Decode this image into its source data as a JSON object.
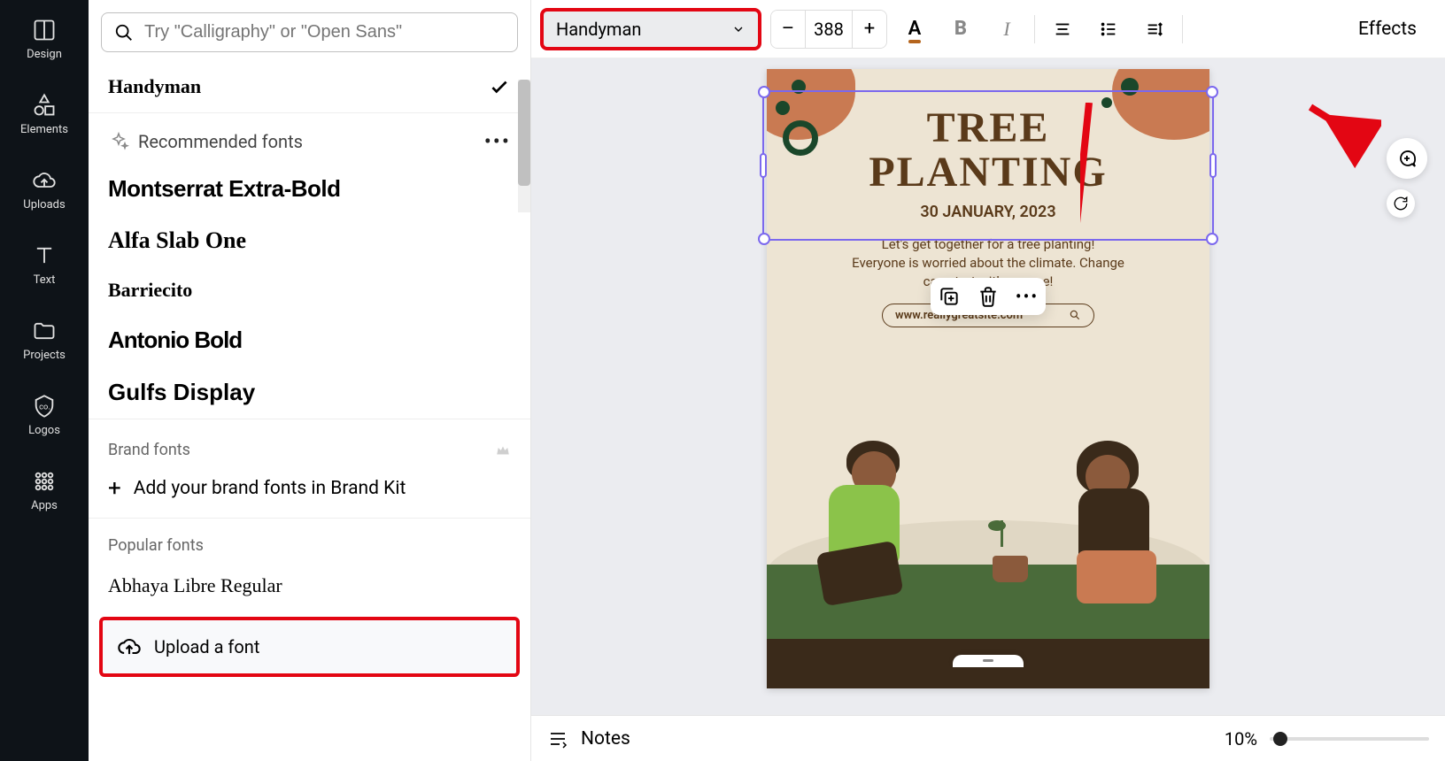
{
  "leftnav": {
    "items": [
      {
        "label": "Design",
        "icon": "design"
      },
      {
        "label": "Elements",
        "icon": "elements"
      },
      {
        "label": "Uploads",
        "icon": "uploads"
      },
      {
        "label": "Text",
        "icon": "text"
      },
      {
        "label": "Projects",
        "icon": "projects"
      },
      {
        "label": "Logos",
        "icon": "logos"
      },
      {
        "label": "Apps",
        "icon": "apps"
      }
    ]
  },
  "panel": {
    "search_placeholder": "Try \"Calligraphy\" or \"Open Sans\"",
    "selected_font": "Handyman",
    "recommended_title": "Recommended fonts",
    "recommended": [
      {
        "name": "Montserrat Extra-Bold",
        "cls": "f-montserrat"
      },
      {
        "name": "Alfa Slab One",
        "cls": "f-alfa"
      },
      {
        "name": "Barriecito",
        "cls": "f-barriecito"
      },
      {
        "name": "Antonio Bold",
        "cls": "f-antonio"
      },
      {
        "name": "Gulfs Display",
        "cls": "f-gulfs"
      }
    ],
    "brand_title": "Brand fonts",
    "add_brand_label": "Add your brand fonts in Brand Kit",
    "popular_title": "Popular fonts",
    "popular": [
      {
        "name": "Abhaya Libre Regular",
        "cls": "f-abhaya"
      }
    ],
    "upload_label": "Upload a font"
  },
  "toolbar": {
    "font_name": "Handyman",
    "minus": "–",
    "size": "388",
    "plus": "+",
    "text_color": "#b5651d",
    "effects_label": "Effects"
  },
  "poster": {
    "title_line1": "TREE",
    "title_line2": "PLANTING",
    "date": "30 JANUARY, 2023",
    "body_line1": "Let's get together for a tree planting!",
    "body_line2": "Everyone is worried about the climate. Change",
    "body_line3": "can start with anyone!",
    "url": "www.reallygreatsite.com"
  },
  "bottom": {
    "notes_label": "Notes",
    "zoom_label": "10%"
  }
}
